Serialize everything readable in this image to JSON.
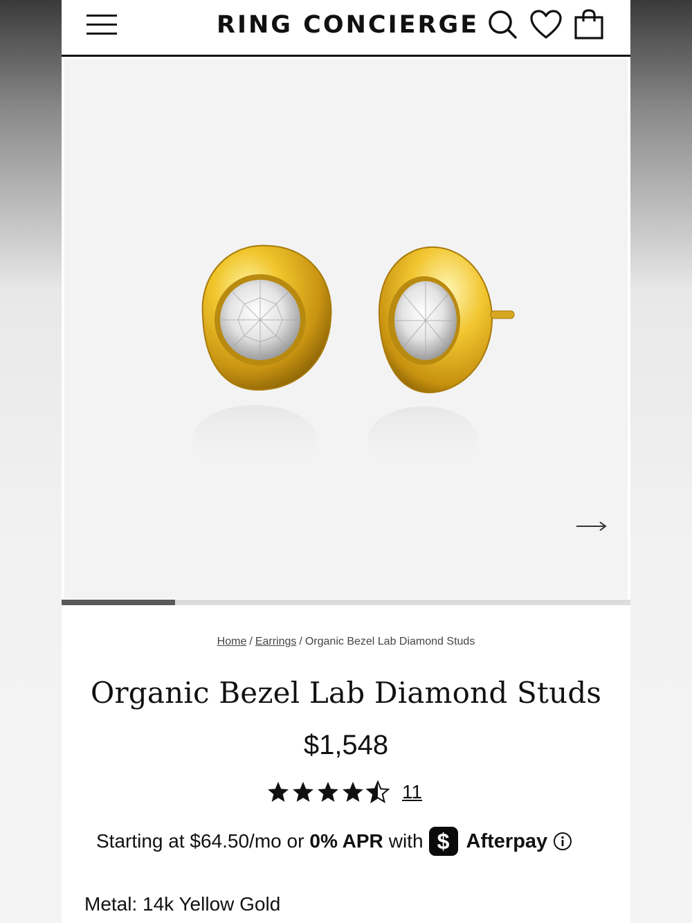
{
  "header": {
    "logo": "RING CONCIERGE",
    "icons": [
      "menu-icon",
      "search-icon",
      "heart-icon",
      "shopping-bag-icon"
    ]
  },
  "gallery": {
    "image_alt": "Organic Bezel Lab Diamond Studs",
    "progress_fraction": 0.2
  },
  "breadcrumb": {
    "home": "Home",
    "sep1": "/",
    "earrings": "Earrings",
    "sep2": "/",
    "current": "Organic Bezel Lab Diamond Studs"
  },
  "product": {
    "title": "Organic Bezel Lab Diamond Studs",
    "price": "$1,548",
    "rating_value": 4.5,
    "rating_max": 5,
    "review_count": "11"
  },
  "finance": {
    "prefix": "Starting at $64.50/mo or",
    "apr": "0% APR",
    "with": "with",
    "cashapp_symbol": "$",
    "provider": "Afterpay"
  },
  "metal": {
    "label": "Metal: 14k Yellow Gold"
  },
  "colors": {
    "gold": "#d4a51a",
    "progress": "#5a5a5a",
    "track": "#dcdcdc",
    "gallery_bg": "#f3f3f3"
  }
}
